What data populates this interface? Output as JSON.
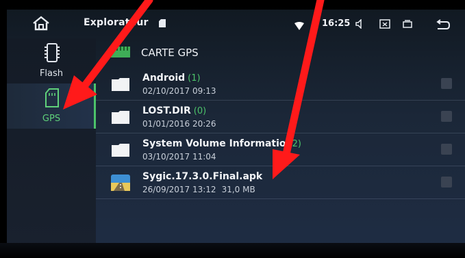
{
  "statusbar": {
    "app_title": "Explorateur",
    "time": "16:25"
  },
  "sidebar": {
    "items": [
      {
        "label": "Flash",
        "active": false
      },
      {
        "label": "GPS",
        "active": true
      }
    ]
  },
  "path": {
    "label": "CARTE GPS"
  },
  "files": [
    {
      "name": "Android",
      "count": "(1)",
      "date": "02/10/2017 09:13",
      "size": "",
      "type": "folder"
    },
    {
      "name": "LOST.DIR",
      "count": "(0)",
      "date": "01/01/2016 20:26",
      "size": "",
      "type": "folder"
    },
    {
      "name": "System Volume Informatio",
      "count": "(2)",
      "date": "03/10/2017 11:04",
      "size": "",
      "type": "folder"
    },
    {
      "name": "Sygic.17.3.0.Final.apk",
      "count": "",
      "date": "26/09/2017 13:12",
      "size": "31,0 MB",
      "type": "apk"
    }
  ],
  "colors": {
    "accent_green": "#4cc36a",
    "annotation_red": "#ff1a1a"
  }
}
